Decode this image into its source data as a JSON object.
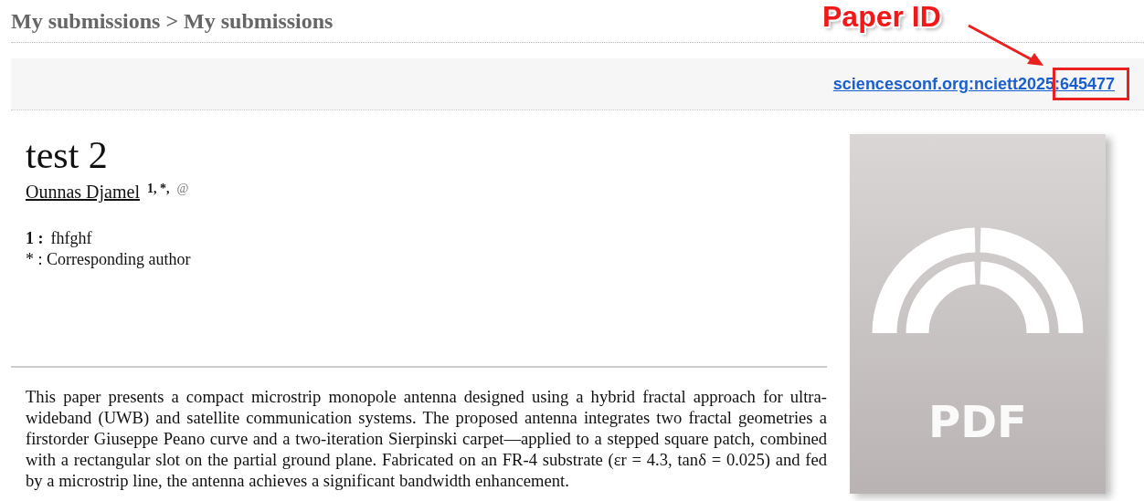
{
  "breadcrumb": "My submissions > My submissions",
  "paper_link": "sciencesconf.org:nciett2025:645477",
  "annotation": {
    "label": "Paper ID"
  },
  "paper": {
    "title": "test 2",
    "authors": [
      {
        "name": "Ounnas Djamel",
        "marks": "1, *,",
        "contact": "@"
      }
    ],
    "affiliations": [
      {
        "number": "1 :",
        "text": "fhfghf"
      }
    ],
    "note": "* : Corresponding author",
    "abstract": "This paper presents a compact microstrip monopole antenna designed using a hybrid fractal approach for ultra-wideband (UWB) and satellite communication systems. The proposed antenna integrates two fractal geometries a firstorder Giuseppe Peano curve and a two-iteration Sierpinski carpet—applied to a stepped square patch, combined with a rectangular slot on the partial ground plane. Fabricated on an FR-4 substrate (εr = 4.3, tanδ = 0.025) and fed by a microstrip line, the antenna achieves a significant bandwidth enhancement."
  },
  "file": {
    "format": "PDF"
  }
}
